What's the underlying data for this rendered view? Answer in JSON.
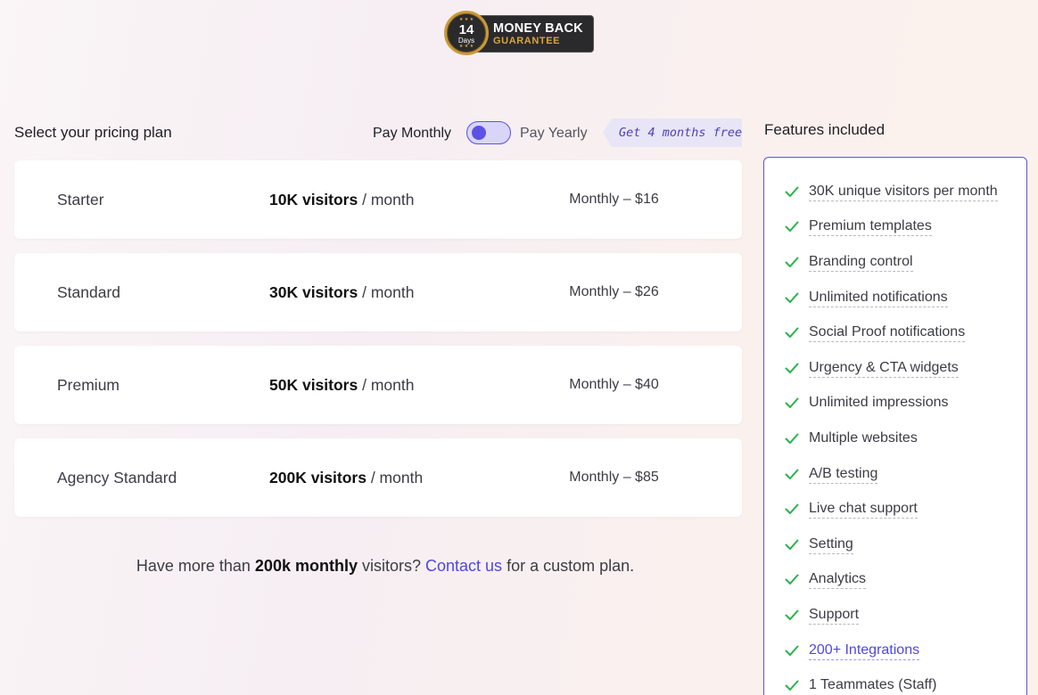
{
  "badge": {
    "number": "14",
    "days": "Days",
    "line1": "MONEY BACK",
    "line2": "GUARANTEE"
  },
  "header": {
    "title": "Select your pricing plan",
    "pay_monthly": "Pay Monthly",
    "pay_yearly": "Pay Yearly",
    "promo": "Get 4 months free",
    "toggle_selected": "Pay Monthly"
  },
  "plans": [
    {
      "name": "Starter",
      "visitors": "10K visitors",
      "per": "/ month",
      "price": "Monthly – $16"
    },
    {
      "name": "Standard",
      "visitors": "30K visitors",
      "per": "/ month",
      "price": "Monthly – $26"
    },
    {
      "name": "Premium",
      "visitors": "50K visitors",
      "per": "/ month",
      "price": "Monthly – $40"
    },
    {
      "name": "Agency Standard",
      "visitors": "200K visitors",
      "per": "/ month",
      "price": "Monthly – $85"
    }
  ],
  "footer": {
    "pre": "Have more than",
    "bold": "200k monthly",
    "mid": "visitors?",
    "link": "Contact us",
    "post": "for a custom plan."
  },
  "features": {
    "title": "Features included",
    "items": [
      {
        "label": "30K unique visitors per month",
        "style": "dashed"
      },
      {
        "label": "Premium templates",
        "style": "dashed"
      },
      {
        "label": "Branding control",
        "style": "dashed"
      },
      {
        "label": "Unlimited notifications",
        "style": "dashed"
      },
      {
        "label": "Social Proof notifications",
        "style": "dashed"
      },
      {
        "label": "Urgency & CTA widgets",
        "style": "dashed"
      },
      {
        "label": "Unlimited impressions",
        "style": "plain"
      },
      {
        "label": "Multiple websites",
        "style": "plain"
      },
      {
        "label": "A/B testing",
        "style": "dashed"
      },
      {
        "label": "Live chat support",
        "style": "dashed"
      },
      {
        "label": "Setting",
        "style": "dashed"
      },
      {
        "label": "Analytics",
        "style": "dashed"
      },
      {
        "label": "Support",
        "style": "dashed"
      },
      {
        "label": "200+ Integrations",
        "style": "link"
      },
      {
        "label": "1 Teammates (Staff)",
        "style": "plain"
      }
    ]
  },
  "colors": {
    "accent": "#5b52e5",
    "check": "#2bb24c",
    "link": "#4e46e5",
    "badge_gold": "#d9a441"
  }
}
